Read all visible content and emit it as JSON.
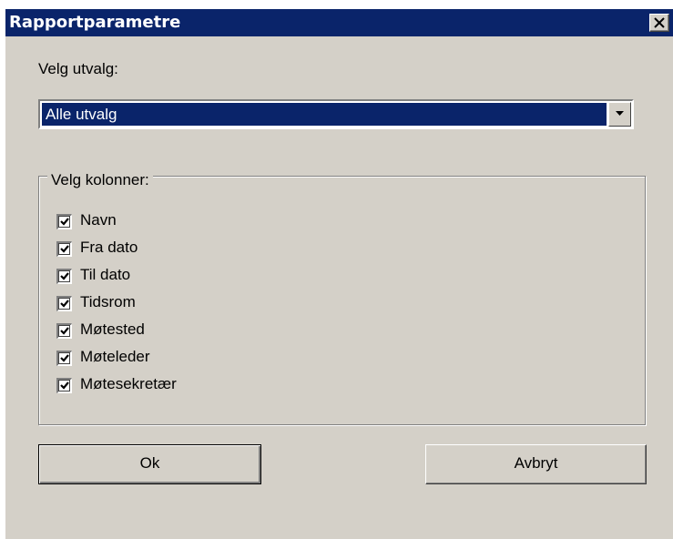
{
  "window": {
    "title": "Rapportparametre",
    "close_label": "×"
  },
  "selection": {
    "label": "Velg utvalg:",
    "value": "Alle utvalg"
  },
  "columns": {
    "legend": "Velg kolonner:",
    "items": [
      {
        "label": "Navn",
        "checked": true
      },
      {
        "label": "Fra dato",
        "checked": true
      },
      {
        "label": "Til dato",
        "checked": true
      },
      {
        "label": "Tidsrom",
        "checked": true
      },
      {
        "label": "Møtested",
        "checked": true
      },
      {
        "label": "Møteleder",
        "checked": true
      },
      {
        "label": "Møtesekretær",
        "checked": true
      }
    ]
  },
  "buttons": {
    "ok": "Ok",
    "cancel": "Avbryt"
  },
  "colors": {
    "titlebar": "#0a246a",
    "face": "#d4d0c8",
    "selection": "#0a246a"
  }
}
